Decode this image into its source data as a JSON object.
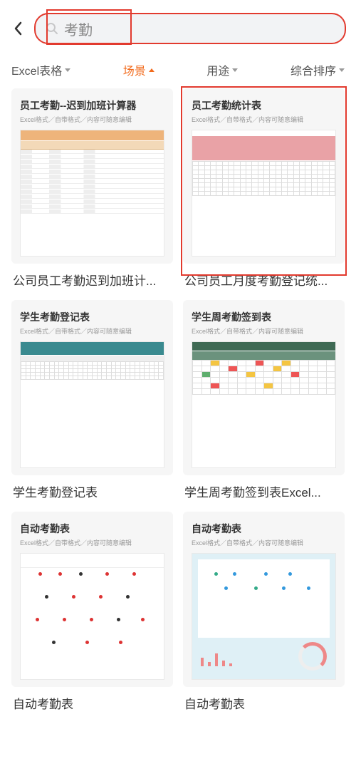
{
  "search": {
    "query": "考勤"
  },
  "filters": [
    {
      "label": "Excel表格",
      "key": "format",
      "active": false
    },
    {
      "label": "场景",
      "key": "scene",
      "active": true
    },
    {
      "label": "用途",
      "key": "usage",
      "active": false
    },
    {
      "label": "综合排序",
      "key": "sort",
      "active": false
    }
  ],
  "cards": [
    {
      "title": "员工考勤--迟到加班计算器",
      "sub": "Excel格式／自带格式／内容可随意编辑",
      "caption": "公司员工考勤迟到加班计...",
      "style": "orange_table"
    },
    {
      "title": "员工考勤统计表",
      "sub": "Excel格式／自带格式／内容可随意编辑",
      "caption": "公司员工月度考勤登记统...",
      "style": "pink_grid",
      "highlight": true
    },
    {
      "title": "学生考勤登记表",
      "sub": "Excel格式／自带格式／内容可随意编辑",
      "caption": "学生考勤登记表",
      "style": "teal_grid"
    },
    {
      "title": "学生周考勤签到表",
      "sub": "Excel格式／自带格式／内容可随意编辑",
      "caption": "学生周考勤签到表Excel...",
      "style": "green_color_grid"
    },
    {
      "title": "自动考勤表",
      "sub": "Excel格式／自带格式／内容可随意编辑",
      "caption": "自动考勤表",
      "style": "dots_red"
    },
    {
      "title": "自动考勤表",
      "sub": "Excel格式／自带格式／内容可随意编辑",
      "caption": "自动考勤表",
      "style": "blue_charts"
    }
  ]
}
